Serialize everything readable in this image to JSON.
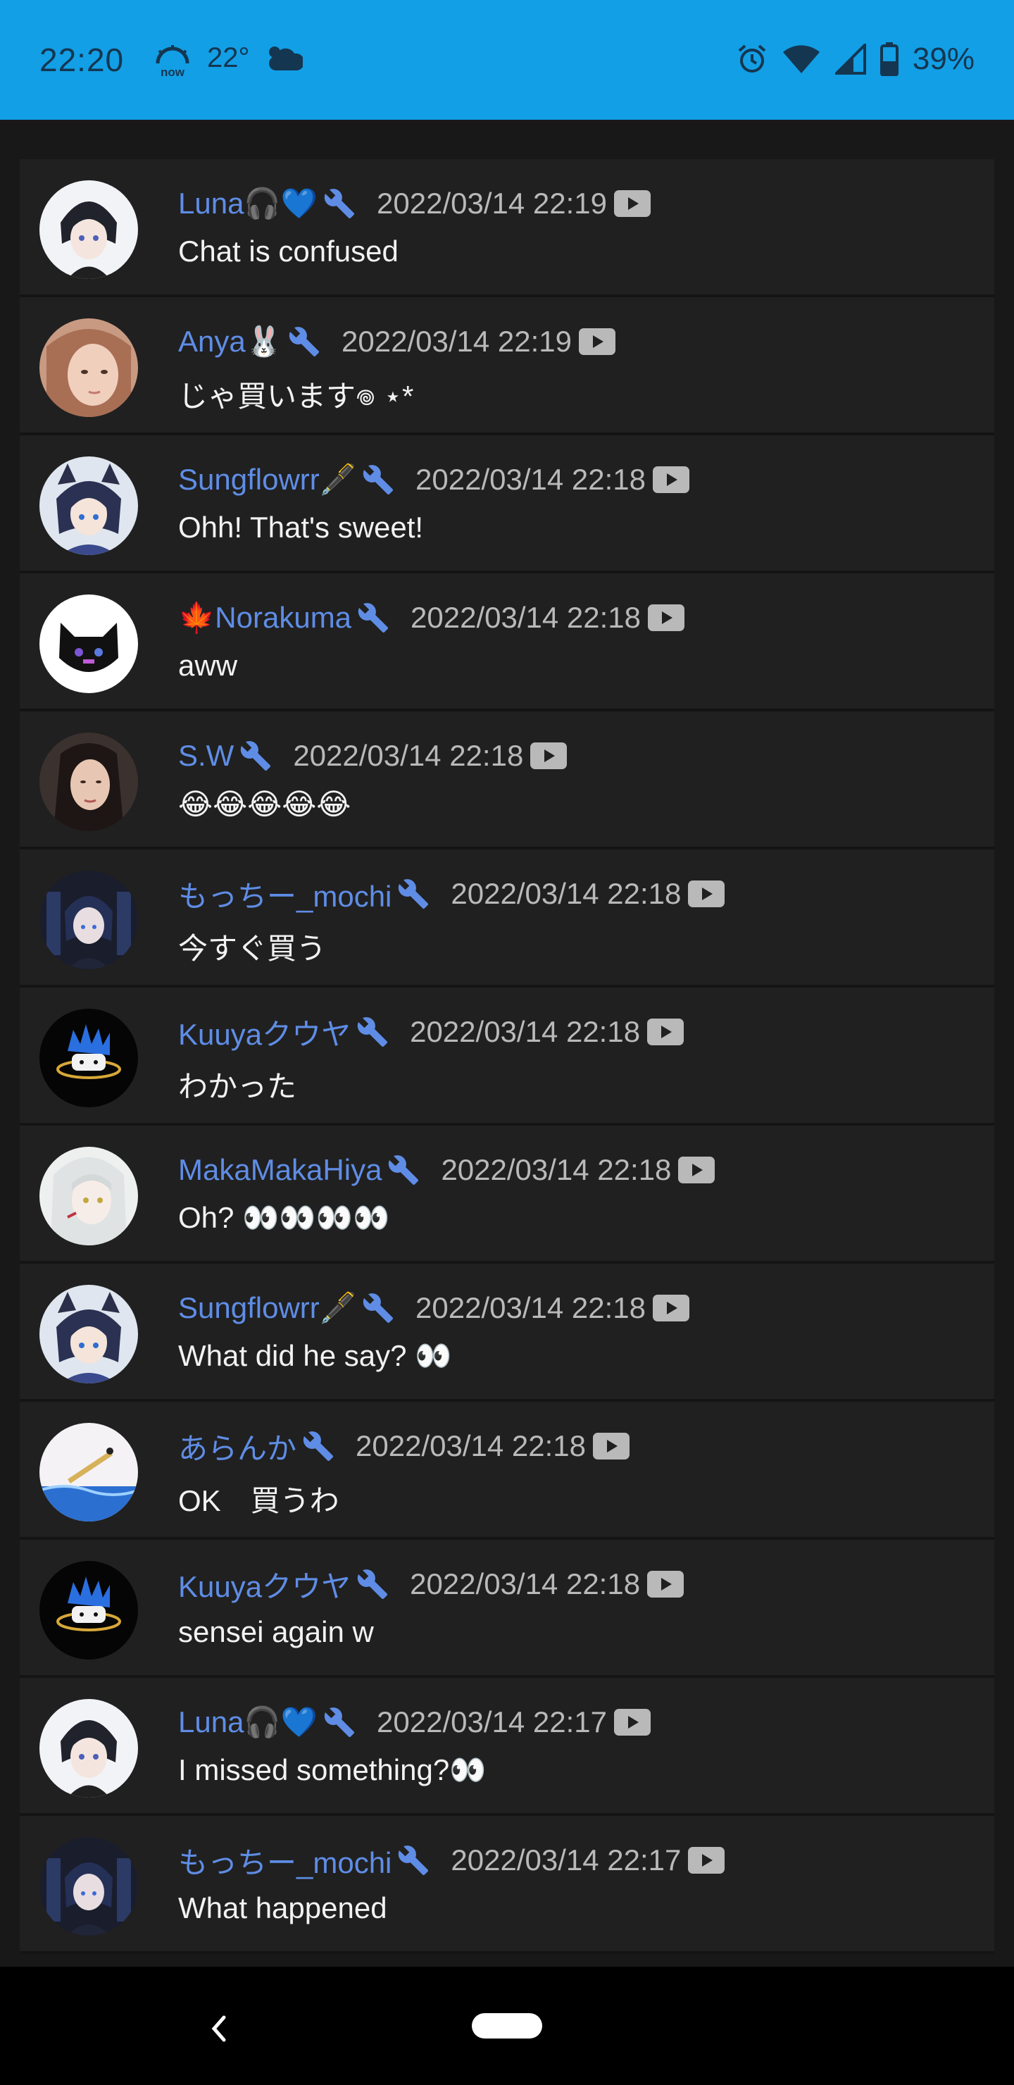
{
  "status_bar": {
    "time": "22:20",
    "now_label": "now",
    "temperature": "22°",
    "battery": "39%",
    "background": "#129fe6"
  },
  "colors": {
    "author": "#5f8de6",
    "timestamp": "#b9b9b9",
    "message": "#f2f2f2",
    "row_bg": "#202020"
  },
  "messages": [
    {
      "author": "Luna🎧💙",
      "time": "2022/03/14 22:19",
      "text": "Chat is confused",
      "avatar": "avatar-luna"
    },
    {
      "author": "Anya🐰",
      "time": "2022/03/14 22:19",
      "text": "じゃ買います𖦹 ⋆*",
      "avatar": "avatar-anya"
    },
    {
      "author": "Sungflowrr🖋️",
      "time": "2022/03/14 22:18",
      "text": "Ohh! That's sweet!",
      "avatar": "avatar-sungflowrr"
    },
    {
      "author": "🍁Norakuma",
      "time": "2022/03/14 22:18",
      "text": "aww",
      "avatar": "avatar-norakuma"
    },
    {
      "author": "S.W",
      "time": "2022/03/14 22:18",
      "text": "😂😂😂😂😂",
      "avatar": "avatar-sw"
    },
    {
      "author": "もっちー_mochi",
      "time": "2022/03/14 22:18",
      "text": "今すぐ買う",
      "avatar": "avatar-mochi"
    },
    {
      "author": "Kuuyaクウヤ",
      "time": "2022/03/14 22:18",
      "text": "わかった",
      "avatar": "avatar-kuuya"
    },
    {
      "author": "MakaMakaHiya",
      "time": "2022/03/14 22:18",
      "text": "Oh? 👀👀👀👀",
      "avatar": "avatar-makamakahiya"
    },
    {
      "author": "Sungflowrr🖋️",
      "time": "2022/03/14 22:18",
      "text": "What did he say? 👀",
      "avatar": "avatar-sungflowrr"
    },
    {
      "author": "あらんか",
      "time": "2022/03/14 22:18",
      "text": "OK　買うわ",
      "avatar": "avatar-aranka"
    },
    {
      "author": "Kuuyaクウヤ",
      "time": "2022/03/14 22:18",
      "text": "sensei again w",
      "avatar": "avatar-kuuya"
    },
    {
      "author": "Luna🎧💙",
      "time": "2022/03/14 22:17",
      "text": "I missed something?👀",
      "avatar": "avatar-luna"
    },
    {
      "author": "もっちー_mochi",
      "time": "2022/03/14 22:17",
      "text": "What happened",
      "avatar": "avatar-mochi"
    }
  ]
}
